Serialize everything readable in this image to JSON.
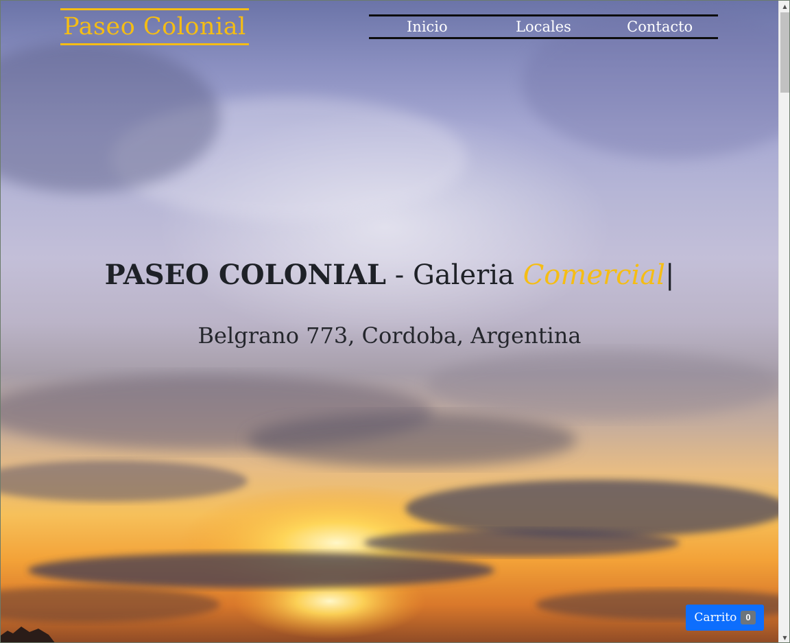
{
  "header": {
    "brand": "Paseo Colonial",
    "nav": [
      {
        "label": "Inicio"
      },
      {
        "label": "Locales"
      },
      {
        "label": "Contacto"
      }
    ]
  },
  "hero": {
    "title_strong": "PASEO COLONIAL",
    "title_separator": " - ",
    "title_rest": "Galeria ",
    "title_accent": "Comercial",
    "title_cursor": "|",
    "address": "Belgrano 773, Cordoba, Argentina"
  },
  "cart": {
    "label": "Carrito",
    "count": "0"
  },
  "colors": {
    "accent": "#f5bd14",
    "cart_button": "#0d6efd",
    "badge": "#6c757d",
    "nav_border": "#0d0d0d"
  },
  "icons": {
    "scroll_up": "up-arrow-icon",
    "scroll_down": "down-arrow-icon"
  }
}
